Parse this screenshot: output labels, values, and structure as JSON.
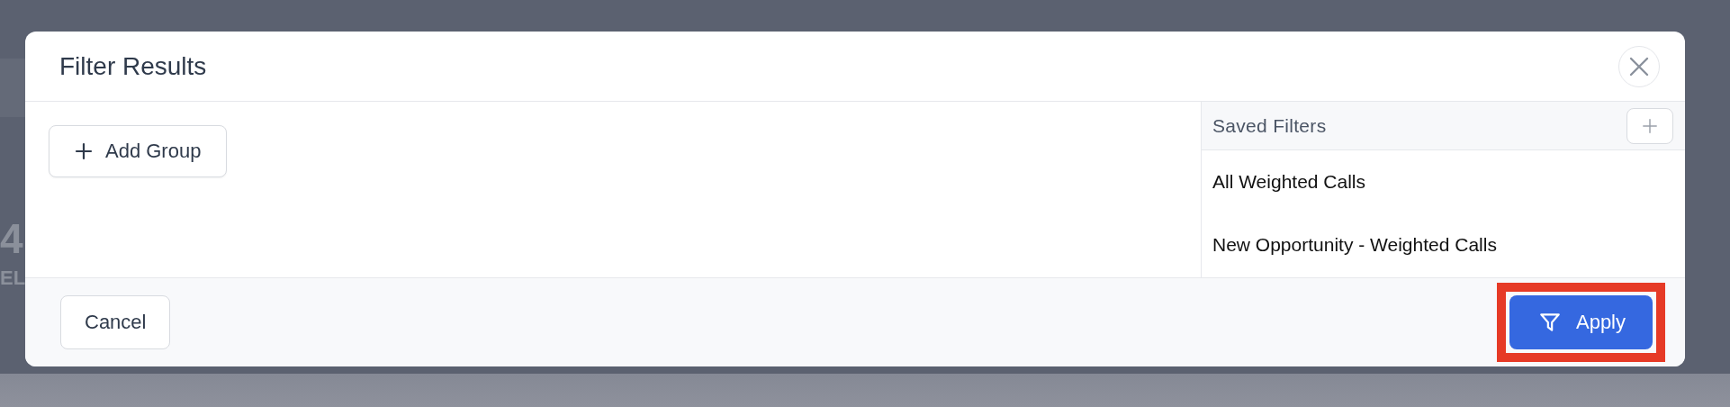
{
  "background": {
    "texts": [
      "4",
      "EL"
    ]
  },
  "dialog": {
    "title": "Filter Results",
    "add_group_button": "Add Group",
    "saved_filters": {
      "title": "Saved Filters",
      "items": [
        {
          "label": "All Weighted Calls"
        },
        {
          "label": "New Opportunity - Weighted Calls"
        }
      ]
    },
    "buttons": [
      {
        "kind": "secondary",
        "label": "Cancel",
        "highlighted": false
      },
      {
        "kind": "primary",
        "label": "Apply",
        "highlighted": true
      }
    ]
  }
}
